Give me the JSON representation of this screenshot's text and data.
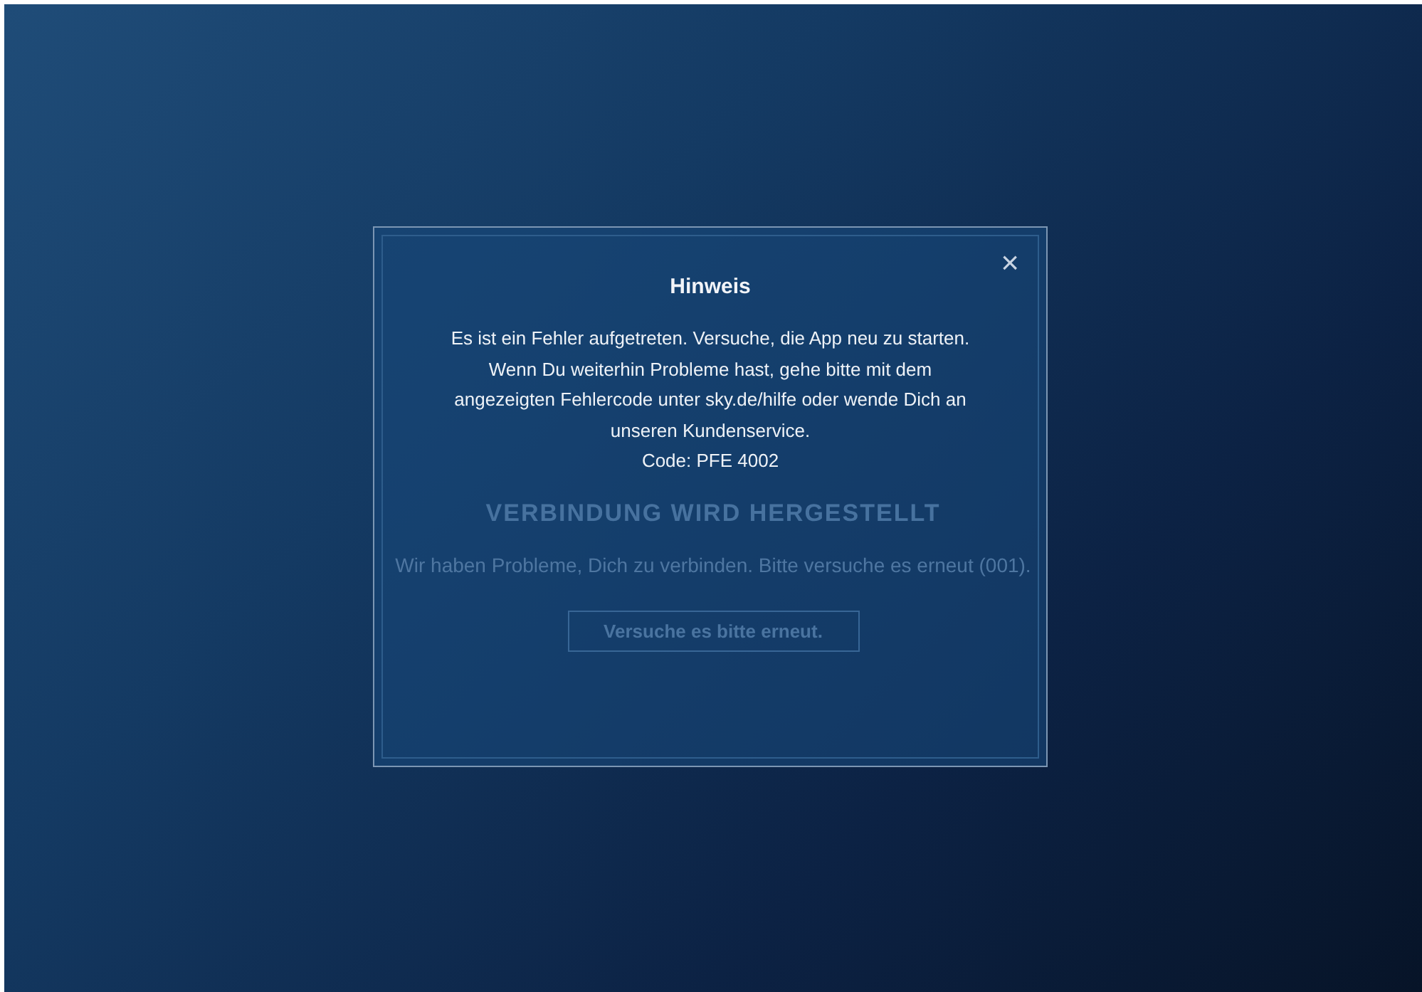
{
  "background": {
    "heading": "VERBINDUNG WIRD HERGESTELLT",
    "message": "Wir haben Probleme, Dich zu verbinden. Bitte versuche es erneut (001).",
    "retry_button": "Versuche es bitte erneut."
  },
  "dialog": {
    "title": "Hinweis",
    "close": "×",
    "message": "Es ist ein Fehler aufgetreten. Versuche, die App neu zu starten. Wenn Du weiterhin Probleme hast, gehe bitte mit dem angezeigten Fehlercode unter sky.de/hilfe oder wende Dich an unseren Kundenservice.",
    "code": "Code: PFE 4002"
  }
}
